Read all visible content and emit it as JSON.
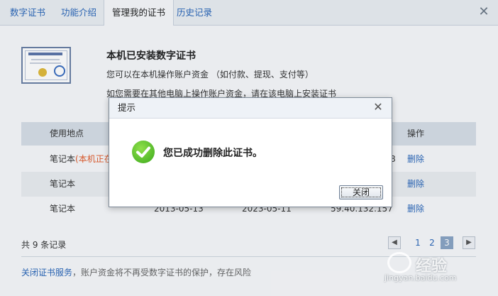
{
  "tabs": [
    {
      "label": "数字证书"
    },
    {
      "label": "功能介绍"
    },
    {
      "label": "管理我的证书"
    },
    {
      "label": "历史记录"
    }
  ],
  "header": {
    "title": "本机已安装数字证书",
    "desc": "您可以在本机操作账户资金 （如付款、提现、支付等）",
    "desc2": "如您需要在其他电脑上操作账户资金，请在该电脑上安装证书"
  },
  "table": {
    "columns": [
      "使用地点",
      "操作"
    ],
    "rows": [
      {
        "place": "笔记本",
        "note": "(本机正在",
        "install_date": "",
        "expire_date": "",
        "ip": "8",
        "action": "删除"
      },
      {
        "place": "笔记本",
        "note": "",
        "install_date": "",
        "expire_date": "",
        "ip": "",
        "action": "删除"
      },
      {
        "place": "笔记本",
        "note": "",
        "install_date": "2013-05-13",
        "expire_date": "2023-05-11",
        "ip": "59.40.132.157",
        "action": "删除"
      }
    ]
  },
  "footer": {
    "count": "共 9 条记录",
    "pages": [
      "1",
      "2",
      "3"
    ],
    "current_page": "3",
    "prev": "◀",
    "next": "▶",
    "close_service_link": "关闭证书服务",
    "close_service_note": "，账户资金将不再受数字证书的保护，存在风险"
  },
  "dialog": {
    "title": "提示",
    "message": "您已成功删除此证书。",
    "close_button": "关闭"
  },
  "watermark": {
    "text": "经验",
    "sub": "jingyan.baidu.com"
  },
  "colors": {
    "link": "#2a66b8",
    "warning": "#e25a2a",
    "success": "#3aa81c"
  }
}
